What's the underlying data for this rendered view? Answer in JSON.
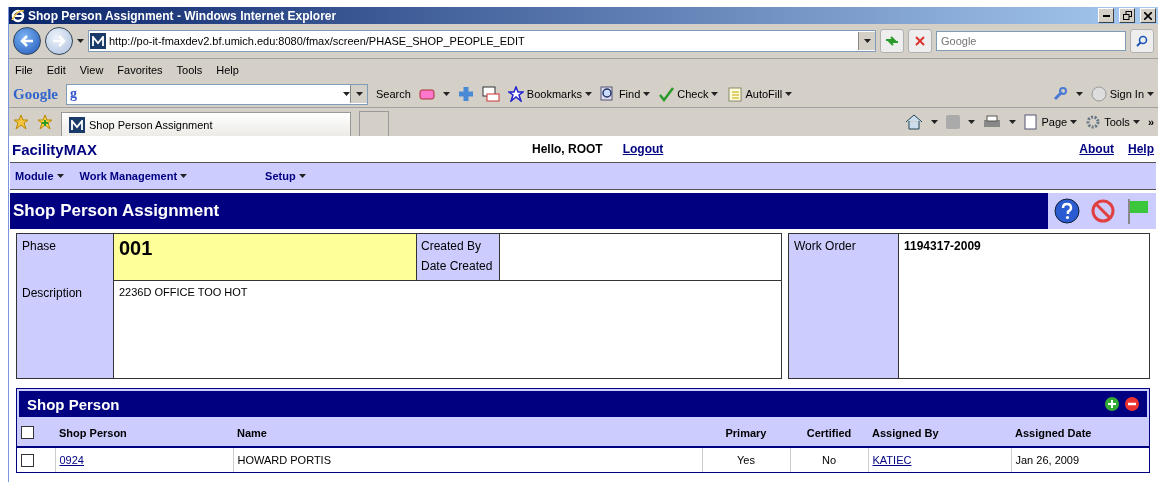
{
  "window": {
    "title": "Shop Person Assignment - Windows Internet Explorer"
  },
  "address_bar": {
    "url": "http://po-it-fmaxdev2.bf.umich.edu:8080/fmax/screen/PHASE_SHOP_PEOPLE_EDIT",
    "search_placeholder": "Google"
  },
  "menu_bar": [
    "File",
    "Edit",
    "View",
    "Favorites",
    "Tools",
    "Help"
  ],
  "google_toolbar": {
    "logo": "Google",
    "field_logo": "g",
    "search_label": "Search",
    "bookmarks": "Bookmarks",
    "find": "Find",
    "check": "Check",
    "autofill": "AutoFill",
    "sign_in": "Sign In"
  },
  "tab": {
    "label": "Shop Person Assignment"
  },
  "command_bar": {
    "page": "Page",
    "tools": "Tools",
    "more": "»"
  },
  "app": {
    "brand": "FacilityMAX",
    "greeting": "Hello, ROOT",
    "logout": "Logout",
    "links": [
      "About",
      "Help"
    ]
  },
  "nav_menu": [
    "Module",
    "Work Management",
    "Setup"
  ],
  "page_title": "Shop Person Assignment",
  "form": {
    "phase_label": "Phase",
    "phase": "001",
    "created_by_label": "Created By",
    "date_created_label": "Date Created",
    "description_label": "Description",
    "description": "2236D OFFICE TOO HOT",
    "work_order_label": "Work Order",
    "work_order": "1194317-2009"
  },
  "shop_person": {
    "title": "Shop Person",
    "columns": [
      "Shop Person",
      "Name",
      "Primary",
      "Certified",
      "Assigned By",
      "Assigned Date"
    ],
    "header_checked": false,
    "rows": [
      {
        "checked": false,
        "shop_person": "0924",
        "name": "HOWARD PORTIS",
        "primary": "Yes",
        "certified": "No",
        "assigned_by": "KATIEC",
        "assigned_date": "Jan 26, 2009"
      }
    ]
  }
}
